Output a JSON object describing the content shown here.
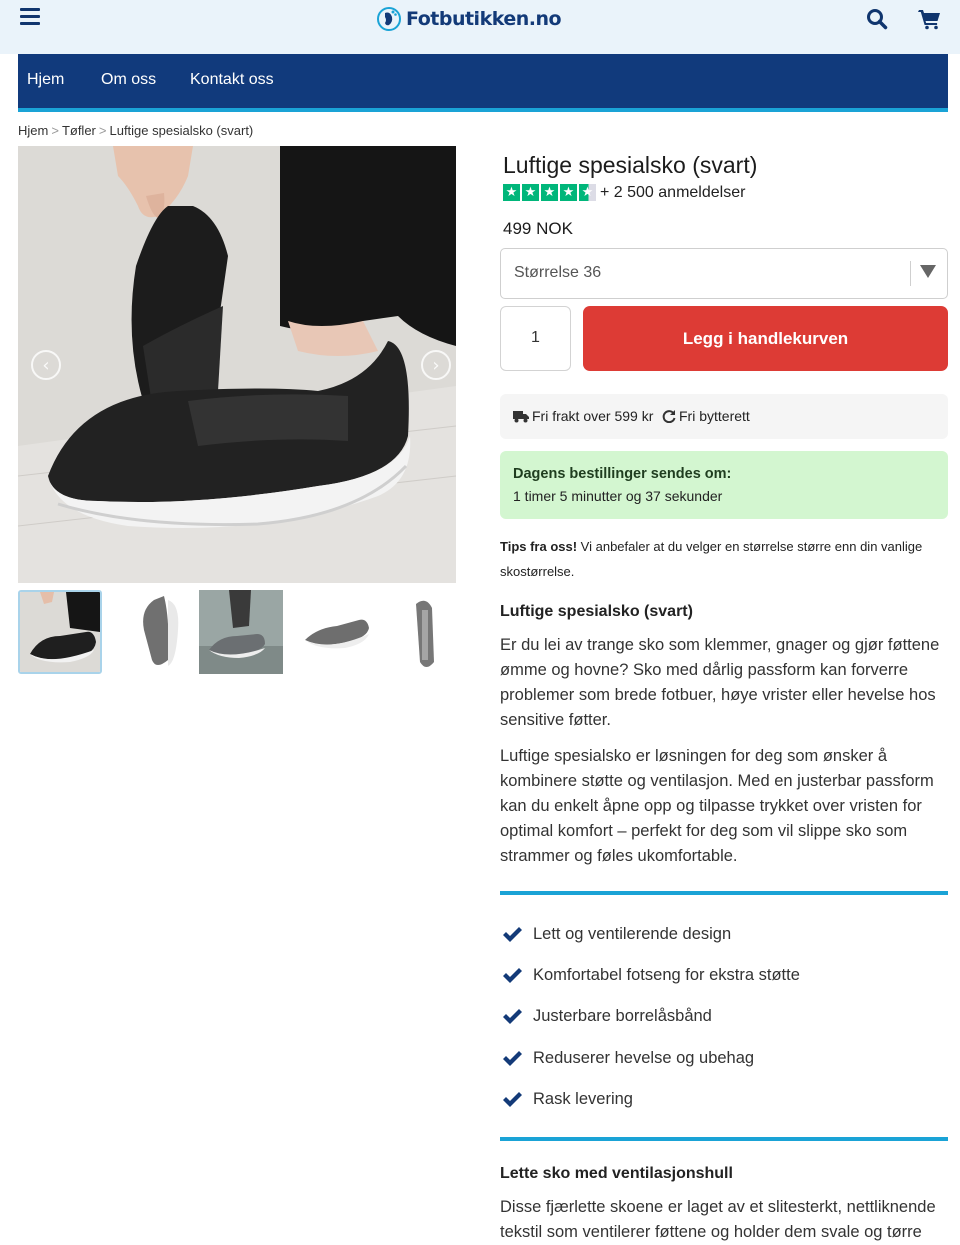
{
  "header": {
    "logo_text": "Fotbutikken.no",
    "menu_icon": "hamburger-menu-icon",
    "search_icon": "search-icon",
    "cart_icon": "shopping-cart-icon"
  },
  "nav": {
    "items": [
      {
        "label": "Hjem"
      },
      {
        "label": "Om oss"
      },
      {
        "label": "Kontakt oss"
      }
    ]
  },
  "breadcrumb": {
    "items": [
      "Hjem",
      "Tøfler",
      "Luftige spesialsko (svart)"
    ],
    "separator": ">"
  },
  "gallery": {
    "prev_icon": "chevron-left-icon",
    "next_icon": "chevron-right-icon",
    "prev_glyph": "‹",
    "next_glyph": "›",
    "thumb_count": 5,
    "active_thumb": 1
  },
  "product": {
    "title": "Luftige spesialsko (svart)",
    "rating": 4.5,
    "rating_max": 5,
    "reviews_text": "+ 2 500 anmeldelser",
    "price": "499 NOK",
    "size_selected": "Størrelse 36",
    "quantity": "1",
    "add_to_cart": "Legg i handlekurven"
  },
  "info": {
    "shipping": "Fri frakt over 599 kr",
    "exchange": "Fri bytterett"
  },
  "countdown": {
    "title": "Dagens bestillinger sendes om:",
    "time": "1 timer 5 minutter og 37 sekunder"
  },
  "tips": {
    "lead": "Tips fra oss!",
    "text": " Vi anbefaler at du velger en størrelse større enn din vanlige skostørrelse."
  },
  "description": {
    "heading": "Luftige spesialsko (svart)",
    "p1": "Er du lei av trange sko som klemmer, gnager og gjør føttene ømme og hovne? Sko med dårlig passform kan forverre problemer som brede fotbuer, høye vrister eller hevelse hos sensitive føtter.",
    "p2": "Luftige spesialsko er løsningen for deg som ønsker å kombinere støtte og ventilasjon. Med en justerbar passform kan du enkelt åpne opp og tilpasse trykket over vristen for optimal komfort – perfekt for deg som vil slippe sko som strammer og føles ukomfortable."
  },
  "features": [
    "Lett og ventilerende design",
    "Komfortabel fotseng for ekstra støtte",
    "Justerbare borrelåsbånd",
    "Reduserer hevelse og ubehag",
    "Rask levering"
  ],
  "section2": {
    "heading": "Lette sko med ventilasjonshull",
    "p1": "Disse fjærlette skoene er laget av et slitesterkt, nettliknende tekstil som ventilerer føttene og holder dem svale og tørre"
  },
  "colors": {
    "nav_bg": "#113a7c",
    "accent_blue": "#1aa3d6",
    "cart_red": "#dd3b35",
    "star_green": "#00b67a",
    "countdown_bg": "#d3f6d0"
  }
}
